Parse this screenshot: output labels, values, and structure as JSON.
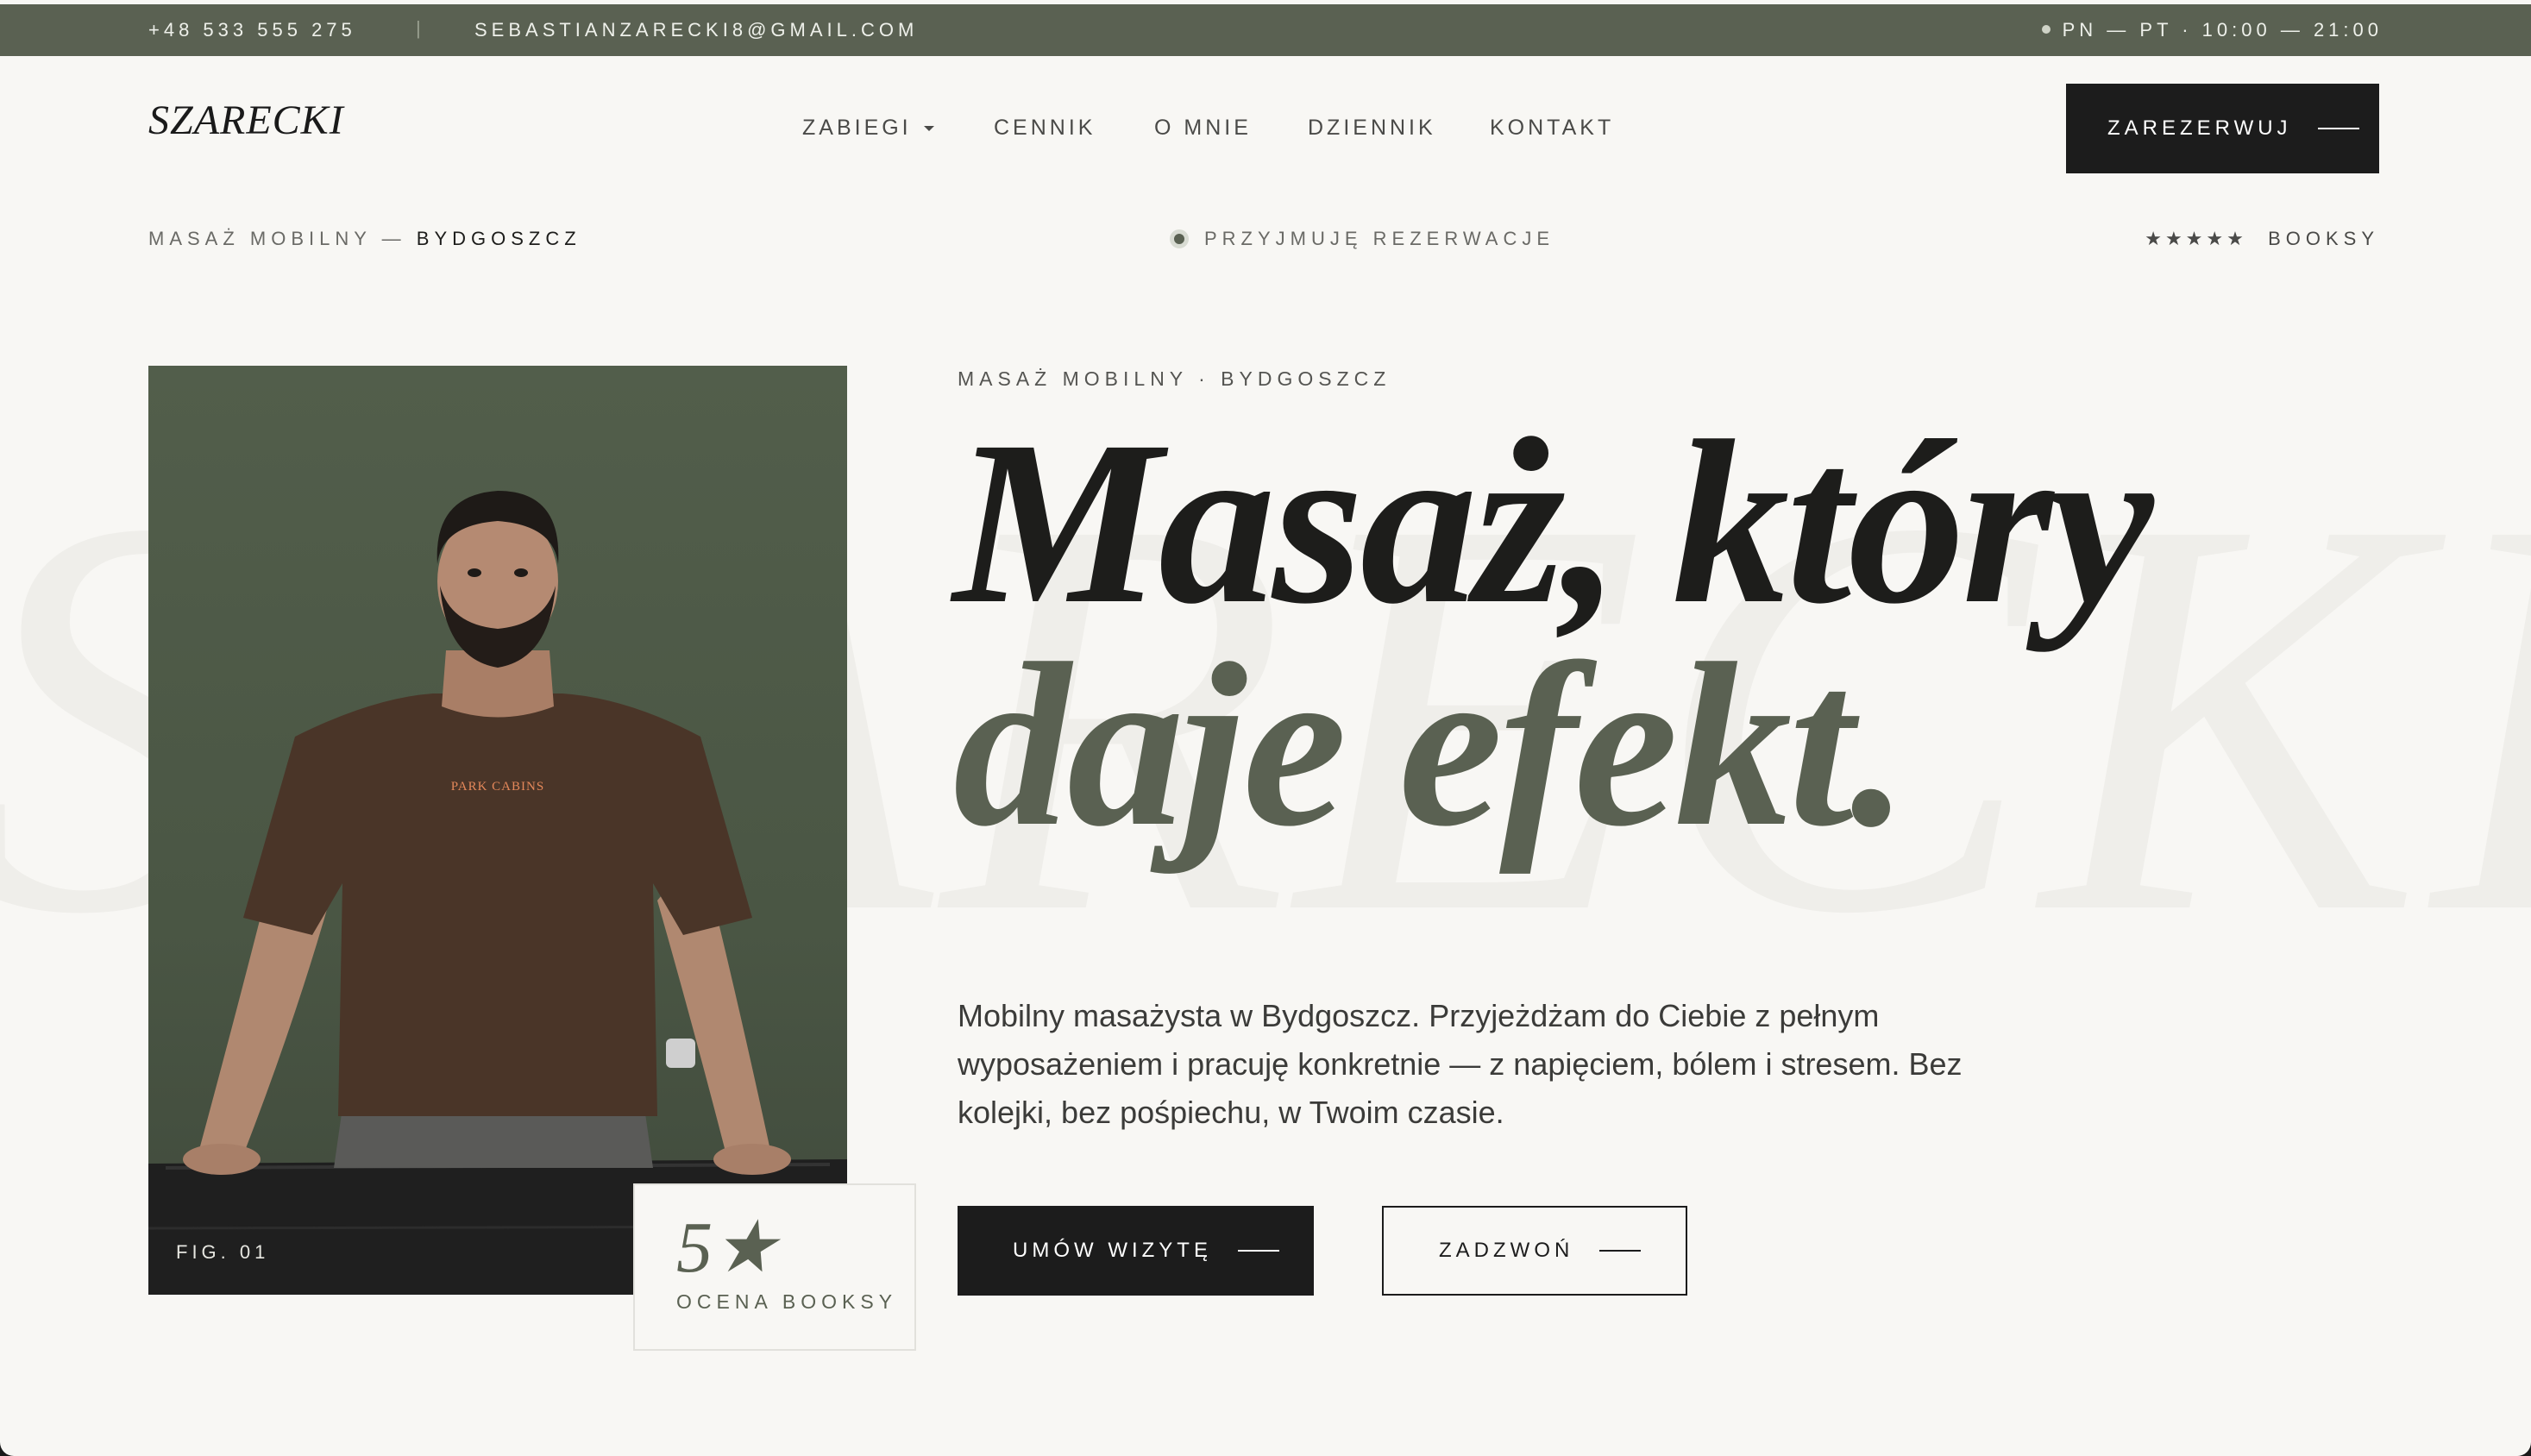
{
  "topbar": {
    "phone": "+48 533 555 275",
    "separator": "|",
    "email": "SEBASTIANZARECKI8@GMAIL.COM",
    "hours": "PN — PT · 10:00 — 21:00"
  },
  "header": {
    "logo": "SZARECKI",
    "nav": [
      "ZABIEGI",
      "CENNIK",
      "O MNIE",
      "DZIENNIK",
      "KONTAKT"
    ],
    "cta_label": "ZAREZERWUJ"
  },
  "subbar": {
    "left_prefix": "MASAŻ MOBILNY —",
    "left_city": "BYDGOSZCZ",
    "status": "PRZYJMUJĘ REZERWACJE",
    "stars": "★★★★★",
    "rating_source": "BOOKSY"
  },
  "watermark": "SZARECKI",
  "hero": {
    "eyebrow": "MASAŻ MOBILNY · BYDGOSZCZ",
    "title_line1": "Masaż, który",
    "title_line2": "daje efekt.",
    "lead": "Mobilny masażysta w Bydgoszcz. Przyjeżdżam do Ciebie z pełnym wyposażeniem i pracuję konkretnie — z napięciem, bólem i stresem. Bez kolejki, bez pośpiechu, w Twoim czasie.",
    "primary_button": "UMÓW WIZYTĘ",
    "secondary_button": "ZADZWOŃ"
  },
  "photo": {
    "caption": "FIG. 01",
    "shirt_print": "PARK CABINS"
  },
  "rating_card": {
    "value": "5★",
    "label": "OCENA BOOKSY"
  },
  "colors": {
    "accent": "#5a6152",
    "dark": "#1c1c1c",
    "background": "#f8f7f4"
  }
}
